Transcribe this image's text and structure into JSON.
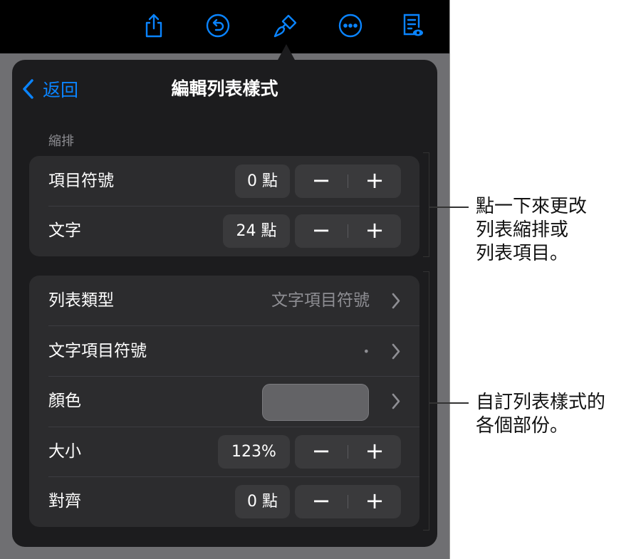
{
  "toolbar": {
    "icons": [
      "share-icon",
      "undo-icon",
      "format-brush-icon",
      "more-icon",
      "reader-view-icon"
    ]
  },
  "popover": {
    "back_label": "返回",
    "title": "編輯列表樣式",
    "indent_section_label": "縮排",
    "indent_rows": [
      {
        "label": "項目符號",
        "value": "0 點"
      },
      {
        "label": "文字",
        "value": "24 點"
      }
    ],
    "style_rows": {
      "list_type": {
        "label": "列表類型",
        "value": "文字項目符號"
      },
      "bullet_text": {
        "label": "文字項目符號",
        "value": "•"
      },
      "color": {
        "label": "顏色",
        "swatch_color": "#636366"
      },
      "size": {
        "label": "大小",
        "value": "123%"
      },
      "align": {
        "label": "對齊",
        "value": "0 點"
      }
    },
    "stepper": {
      "minus": "−",
      "plus": "+"
    }
  },
  "callouts": {
    "top_lines": [
      "點一下來更改",
      "列表縮排或",
      "列表項目。"
    ],
    "bottom_lines": [
      "自訂列表樣式的",
      "各個部份。"
    ]
  },
  "colors": {
    "accent": "#0a84ff",
    "popover_bg": "#1c1c1e",
    "group_bg": "#2c2c2e",
    "control_bg": "#3a3a3c"
  }
}
